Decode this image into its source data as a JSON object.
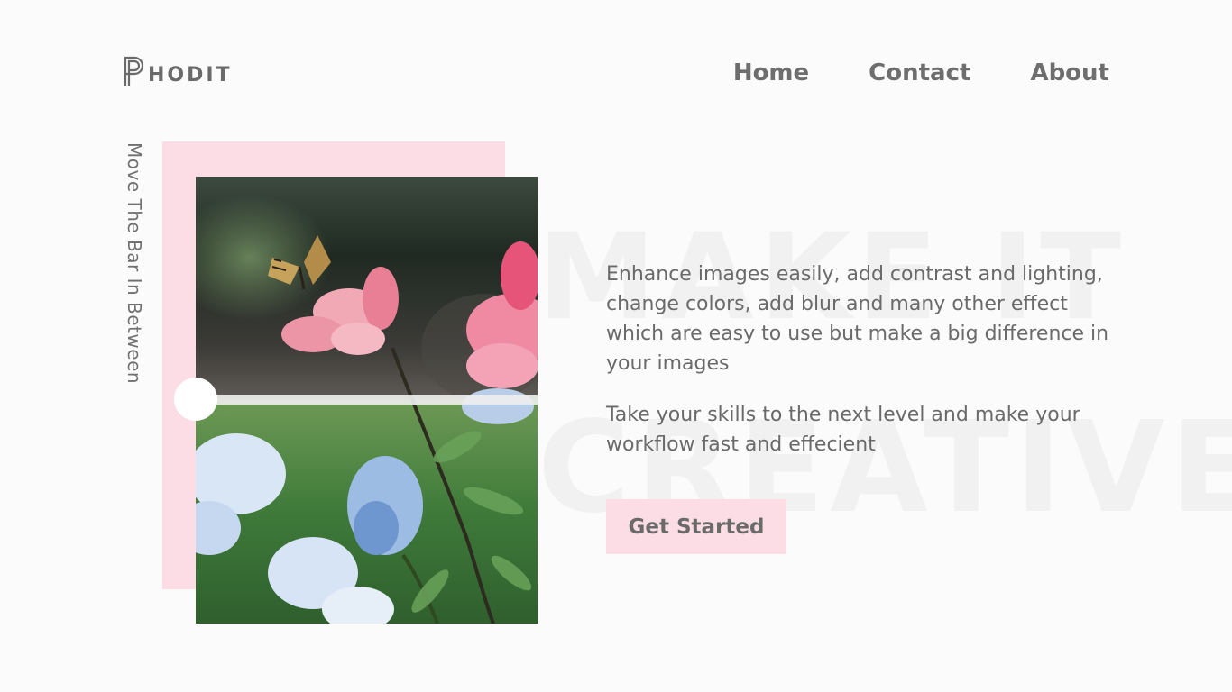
{
  "brand": {
    "logo_text": "HODIT",
    "logo_letter_icon": "p-letter-icon"
  },
  "nav": {
    "items": [
      "Home",
      "Contact",
      "About"
    ]
  },
  "slider": {
    "caption": "Move The Bar In Between",
    "position_fraction": 0.5
  },
  "hero": {
    "watermark_line1": "MAKE IT",
    "watermark_line2": "CREATIVE",
    "paragraph1": "Enhance images easily, add contrast and lighting, change colors, add blur and many other effect which are easy to use but make a big difference in your images",
    "paragraph2": "Take your skills to the next level and make your workflow fast and effecient",
    "cta_label": "Get Started"
  },
  "colors": {
    "accent_pink": "#fddde5",
    "text_gray": "#6a6a6a",
    "background": "#fbfbfb"
  }
}
